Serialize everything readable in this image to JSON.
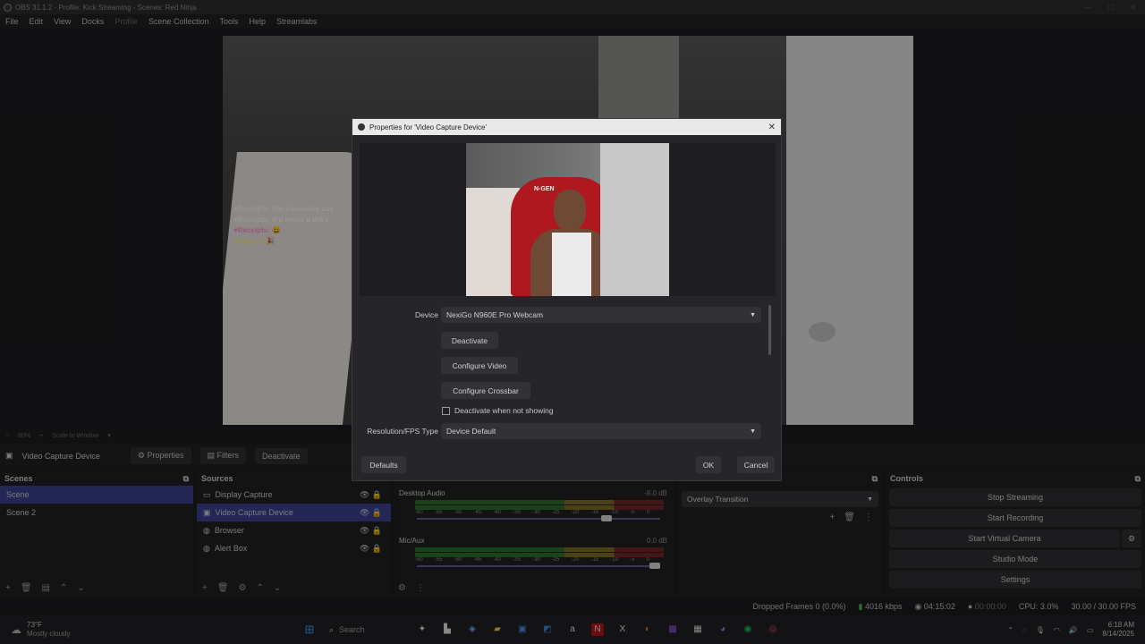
{
  "window": {
    "title": "OBS 31.1.2 - Profile: Kick Streaming - Scenes: Red Ninja",
    "controls": [
      "—",
      "☐",
      "✕"
    ]
  },
  "menu": [
    "File",
    "Edit",
    "View",
    "Docks",
    "Profile",
    "Scene Collection",
    "Tools",
    "Help",
    "Streamlabs"
  ],
  "preview": {
    "zoom": "60%",
    "scale_mode": "Scale to Window",
    "chat_lines": [
      "♥Receipts: bro harassing cus",
      "♥Receipts: tf u mean u got c",
      "♥Receipts: 😀",
      "♥wyay: ♥ 🎉"
    ]
  },
  "source_toolbar": {
    "source_name": "Video Capture Device",
    "properties_label": "Properties",
    "filters_label": "Filters",
    "deactivate_label": "Deactivate"
  },
  "dialog": {
    "title": "Properties for 'Video Capture Device'",
    "webcam_brand": "N-GEN",
    "device_label": "Device",
    "device_value": "NexiGo N960E Pro Webcam",
    "deactivate_btn": "Deactivate",
    "configure_video_btn": "Configure Video",
    "configure_crossbar_btn": "Configure Crossbar",
    "deactivate_checkbox": "Deactivate when not showing",
    "resolution_label": "Resolution/FPS Type",
    "resolution_value": "Device Default",
    "defaults_btn": "Defaults",
    "ok_btn": "OK",
    "cancel_btn": "Cancel"
  },
  "scenes": {
    "title": "Scenes",
    "items": [
      {
        "label": "Scene",
        "selected": true
      },
      {
        "label": "Scene 2",
        "selected": false
      }
    ]
  },
  "sources": {
    "title": "Sources",
    "items": [
      {
        "label": "Display Capture",
        "icon": "monitor-icon"
      },
      {
        "label": "Video Capture Device",
        "icon": "camera-icon"
      },
      {
        "label": "Browser",
        "icon": "globe-icon"
      },
      {
        "label": "Alert Box",
        "icon": "globe-icon"
      }
    ]
  },
  "mixer": {
    "tracks": [
      {
        "name": "Desktop Audio",
        "db": "-8.0 dB",
        "volume": 0.8
      },
      {
        "name": "Mic/Aux",
        "db": "0.0 dB",
        "volume": 1.0
      }
    ],
    "ticks": [
      "-60",
      "-55",
      "-50",
      "-45",
      "-40",
      "-35",
      "-30",
      "-25",
      "-20",
      "-15",
      "-10",
      "-5",
      "0"
    ]
  },
  "transitions": {
    "value": "Overlay Transition"
  },
  "controls": {
    "title": "Controls",
    "buttons": [
      "Stop Streaming",
      "Start Recording",
      "Start Virtual Camera",
      "Studio Mode",
      "Settings"
    ]
  },
  "status": {
    "dropped": "Dropped Frames 0 (0.0%)",
    "bitrate": "4016 kbps",
    "stream_time": "04:15:02",
    "rec_time": "00:00:00",
    "cpu": "CPU: 3.0%",
    "fps": "30.00 / 30.00 FPS"
  },
  "taskbar": {
    "weather_temp": "73°F",
    "weather_desc": "Mostly cloudy",
    "search_placeholder": "Search",
    "time": "6:18 AM",
    "date": "8/14/2025"
  },
  "colors": {
    "accent": "#3a3f8c",
    "meter_green": "#2b6d2b",
    "meter_yellow": "#7a6a22",
    "meter_red": "#6e2424"
  }
}
